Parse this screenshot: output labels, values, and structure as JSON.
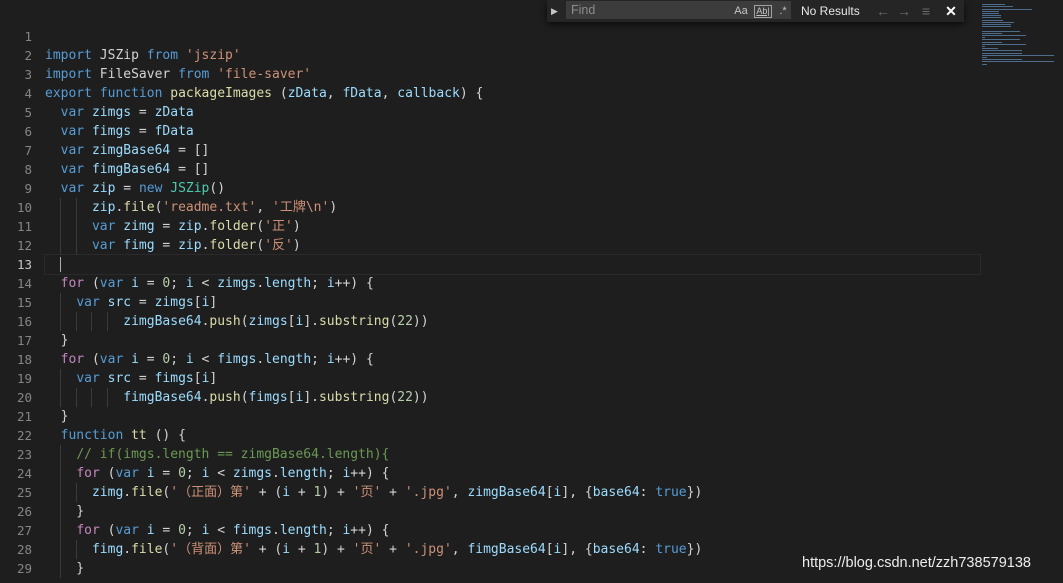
{
  "find": {
    "placeholder": "Find",
    "case_label": "Aa",
    "word_label": "Ab|",
    "regex_label": ".*",
    "results": "No Results"
  },
  "line_numbers": [
    "1",
    "2",
    "3",
    "4",
    "5",
    "6",
    "7",
    "8",
    "9",
    "10",
    "11",
    "12",
    "13",
    "14",
    "15",
    "16",
    "17",
    "18",
    "19",
    "20",
    "21",
    "22",
    "23",
    "24",
    "25",
    "26",
    "27",
    "28",
    "29"
  ],
  "current_line": "13",
  "code": [
    [],
    [
      [
        "kw",
        "import"
      ],
      [
        "tx",
        " JSZip "
      ],
      [
        "kw",
        "from"
      ],
      [
        "tx",
        " "
      ],
      [
        "str",
        "'jszip'"
      ]
    ],
    [
      [
        "kw",
        "import"
      ],
      [
        "tx",
        " FileSaver "
      ],
      [
        "kw",
        "from"
      ],
      [
        "tx",
        " "
      ],
      [
        "str",
        "'file-saver'"
      ]
    ],
    [
      [
        "kw",
        "export"
      ],
      [
        "tx",
        " "
      ],
      [
        "kw",
        "function"
      ],
      [
        "tx",
        " "
      ],
      [
        "fn",
        "packageImages"
      ],
      [
        "tx",
        " ("
      ],
      [
        "var",
        "zData"
      ],
      [
        "tx",
        ", "
      ],
      [
        "var",
        "fData"
      ],
      [
        "tx",
        ", "
      ],
      [
        "var",
        "callback"
      ],
      [
        "tx",
        ") {"
      ]
    ],
    [
      [
        "tx",
        "  "
      ],
      [
        "kw",
        "var"
      ],
      [
        "tx",
        " "
      ],
      [
        "var",
        "zimgs"
      ],
      [
        "tx",
        " = "
      ],
      [
        "var",
        "zData"
      ]
    ],
    [
      [
        "tx",
        "  "
      ],
      [
        "kw",
        "var"
      ],
      [
        "tx",
        " "
      ],
      [
        "var",
        "fimgs"
      ],
      [
        "tx",
        " = "
      ],
      [
        "var",
        "fData"
      ]
    ],
    [
      [
        "tx",
        "  "
      ],
      [
        "kw",
        "var"
      ],
      [
        "tx",
        " "
      ],
      [
        "var",
        "zimgBase64"
      ],
      [
        "tx",
        " = []"
      ]
    ],
    [
      [
        "tx",
        "  "
      ],
      [
        "kw",
        "var"
      ],
      [
        "tx",
        " "
      ],
      [
        "var",
        "fimgBase64"
      ],
      [
        "tx",
        " = []"
      ]
    ],
    [
      [
        "tx",
        "  "
      ],
      [
        "kw",
        "var"
      ],
      [
        "tx",
        " "
      ],
      [
        "var",
        "zip"
      ],
      [
        "tx",
        " = "
      ],
      [
        "kw",
        "new"
      ],
      [
        "tx",
        " "
      ],
      [
        "cls",
        "JSZip"
      ],
      [
        "tx",
        "()"
      ]
    ],
    [
      [
        "tx",
        "      "
      ],
      [
        "var",
        "zip"
      ],
      [
        "tx",
        "."
      ],
      [
        "fn",
        "file"
      ],
      [
        "tx",
        "("
      ],
      [
        "str",
        "'readme.txt'"
      ],
      [
        "tx",
        ", "
      ],
      [
        "str",
        "'工牌\\n'"
      ],
      [
        "tx",
        ")"
      ]
    ],
    [
      [
        "tx",
        "      "
      ],
      [
        "kw",
        "var"
      ],
      [
        "tx",
        " "
      ],
      [
        "var",
        "zimg"
      ],
      [
        "tx",
        " = "
      ],
      [
        "var",
        "zip"
      ],
      [
        "tx",
        "."
      ],
      [
        "fn",
        "folder"
      ],
      [
        "tx",
        "("
      ],
      [
        "str",
        "'正'"
      ],
      [
        "tx",
        ")"
      ]
    ],
    [
      [
        "tx",
        "      "
      ],
      [
        "kw",
        "var"
      ],
      [
        "tx",
        " "
      ],
      [
        "var",
        "fimg"
      ],
      [
        "tx",
        " = "
      ],
      [
        "var",
        "zip"
      ],
      [
        "tx",
        "."
      ],
      [
        "fn",
        "folder"
      ],
      [
        "tx",
        "("
      ],
      [
        "str",
        "'反'"
      ],
      [
        "tx",
        ")"
      ]
    ],
    [],
    [
      [
        "tx",
        "  "
      ],
      [
        "ctl",
        "for"
      ],
      [
        "tx",
        " ("
      ],
      [
        "kw",
        "var"
      ],
      [
        "tx",
        " "
      ],
      [
        "var",
        "i"
      ],
      [
        "tx",
        " = "
      ],
      [
        "num",
        "0"
      ],
      [
        "tx",
        "; "
      ],
      [
        "var",
        "i"
      ],
      [
        "tx",
        " < "
      ],
      [
        "var",
        "zimgs"
      ],
      [
        "tx",
        "."
      ],
      [
        "var",
        "length"
      ],
      [
        "tx",
        "; "
      ],
      [
        "var",
        "i"
      ],
      [
        "tx",
        "++) {"
      ]
    ],
    [
      [
        "tx",
        "    "
      ],
      [
        "kw",
        "var"
      ],
      [
        "tx",
        " "
      ],
      [
        "var",
        "src"
      ],
      [
        "tx",
        " = "
      ],
      [
        "var",
        "zimgs"
      ],
      [
        "tx",
        "["
      ],
      [
        "var",
        "i"
      ],
      [
        "tx",
        "]"
      ]
    ],
    [
      [
        "tx",
        "          "
      ],
      [
        "var",
        "zimgBase64"
      ],
      [
        "tx",
        "."
      ],
      [
        "fn",
        "push"
      ],
      [
        "tx",
        "("
      ],
      [
        "var",
        "zimgs"
      ],
      [
        "tx",
        "["
      ],
      [
        "var",
        "i"
      ],
      [
        "tx",
        "]."
      ],
      [
        "fn",
        "substring"
      ],
      [
        "tx",
        "("
      ],
      [
        "num",
        "22"
      ],
      [
        "tx",
        "))"
      ]
    ],
    [
      [
        "tx",
        "  }"
      ]
    ],
    [
      [
        "tx",
        "  "
      ],
      [
        "ctl",
        "for"
      ],
      [
        "tx",
        " ("
      ],
      [
        "kw",
        "var"
      ],
      [
        "tx",
        " "
      ],
      [
        "var",
        "i"
      ],
      [
        "tx",
        " = "
      ],
      [
        "num",
        "0"
      ],
      [
        "tx",
        "; "
      ],
      [
        "var",
        "i"
      ],
      [
        "tx",
        " < "
      ],
      [
        "var",
        "fimgs"
      ],
      [
        "tx",
        "."
      ],
      [
        "var",
        "length"
      ],
      [
        "tx",
        "; "
      ],
      [
        "var",
        "i"
      ],
      [
        "tx",
        "++) {"
      ]
    ],
    [
      [
        "tx",
        "    "
      ],
      [
        "kw",
        "var"
      ],
      [
        "tx",
        " "
      ],
      [
        "var",
        "src"
      ],
      [
        "tx",
        " = "
      ],
      [
        "var",
        "fimgs"
      ],
      [
        "tx",
        "["
      ],
      [
        "var",
        "i"
      ],
      [
        "tx",
        "]"
      ]
    ],
    [
      [
        "tx",
        "          "
      ],
      [
        "var",
        "fimgBase64"
      ],
      [
        "tx",
        "."
      ],
      [
        "fn",
        "push"
      ],
      [
        "tx",
        "("
      ],
      [
        "var",
        "fimgs"
      ],
      [
        "tx",
        "["
      ],
      [
        "var",
        "i"
      ],
      [
        "tx",
        "]."
      ],
      [
        "fn",
        "substring"
      ],
      [
        "tx",
        "("
      ],
      [
        "num",
        "22"
      ],
      [
        "tx",
        "))"
      ]
    ],
    [
      [
        "tx",
        "  }"
      ]
    ],
    [
      [
        "tx",
        "  "
      ],
      [
        "kw",
        "function"
      ],
      [
        "tx",
        " "
      ],
      [
        "fn",
        "tt"
      ],
      [
        "tx",
        " () {"
      ]
    ],
    [
      [
        "tx",
        "    "
      ],
      [
        "cm",
        "// if(imgs.length == zimgBase64.length){"
      ]
    ],
    [
      [
        "tx",
        "    "
      ],
      [
        "ctl",
        "for"
      ],
      [
        "tx",
        " ("
      ],
      [
        "kw",
        "var"
      ],
      [
        "tx",
        " "
      ],
      [
        "var",
        "i"
      ],
      [
        "tx",
        " = "
      ],
      [
        "num",
        "0"
      ],
      [
        "tx",
        "; "
      ],
      [
        "var",
        "i"
      ],
      [
        "tx",
        " < "
      ],
      [
        "var",
        "zimgs"
      ],
      [
        "tx",
        "."
      ],
      [
        "var",
        "length"
      ],
      [
        "tx",
        "; "
      ],
      [
        "var",
        "i"
      ],
      [
        "tx",
        "++) {"
      ]
    ],
    [
      [
        "tx",
        "      "
      ],
      [
        "var",
        "zimg"
      ],
      [
        "tx",
        "."
      ],
      [
        "fn",
        "file"
      ],
      [
        "tx",
        "("
      ],
      [
        "str",
        "'（正面）第'"
      ],
      [
        "tx",
        " + ("
      ],
      [
        "var",
        "i"
      ],
      [
        "tx",
        " + "
      ],
      [
        "num",
        "1"
      ],
      [
        "tx",
        ") + "
      ],
      [
        "str",
        "'页'"
      ],
      [
        "tx",
        " + "
      ],
      [
        "str",
        "'.jpg'"
      ],
      [
        "tx",
        ", "
      ],
      [
        "var",
        "zimgBase64"
      ],
      [
        "tx",
        "["
      ],
      [
        "var",
        "i"
      ],
      [
        "tx",
        "], {"
      ],
      [
        "var",
        "base64"
      ],
      [
        "tx",
        ": "
      ],
      [
        "kw",
        "true"
      ],
      [
        "tx",
        "})"
      ]
    ],
    [
      [
        "tx",
        "    }"
      ]
    ],
    [
      [
        "tx",
        "    "
      ],
      [
        "ctl",
        "for"
      ],
      [
        "tx",
        " ("
      ],
      [
        "kw",
        "var"
      ],
      [
        "tx",
        " "
      ],
      [
        "var",
        "i"
      ],
      [
        "tx",
        " = "
      ],
      [
        "num",
        "0"
      ],
      [
        "tx",
        "; "
      ],
      [
        "var",
        "i"
      ],
      [
        "tx",
        " < "
      ],
      [
        "var",
        "fimgs"
      ],
      [
        "tx",
        "."
      ],
      [
        "var",
        "length"
      ],
      [
        "tx",
        "; "
      ],
      [
        "var",
        "i"
      ],
      [
        "tx",
        "++) {"
      ]
    ],
    [
      [
        "tx",
        "      "
      ],
      [
        "var",
        "fimg"
      ],
      [
        "tx",
        "."
      ],
      [
        "fn",
        "file"
      ],
      [
        "tx",
        "("
      ],
      [
        "str",
        "'（背面）第'"
      ],
      [
        "tx",
        " + ("
      ],
      [
        "var",
        "i"
      ],
      [
        "tx",
        " + "
      ],
      [
        "num",
        "1"
      ],
      [
        "tx",
        ") + "
      ],
      [
        "str",
        "'页'"
      ],
      [
        "tx",
        " + "
      ],
      [
        "str",
        "'.jpg'"
      ],
      [
        "tx",
        ", "
      ],
      [
        "var",
        "fimgBase64"
      ],
      [
        "tx",
        "["
      ],
      [
        "var",
        "i"
      ],
      [
        "tx",
        "], {"
      ],
      [
        "var",
        "base64"
      ],
      [
        "tx",
        ": "
      ],
      [
        "kw",
        "true"
      ],
      [
        "tx",
        "})"
      ]
    ],
    [
      [
        "tx",
        "    }"
      ]
    ]
  ],
  "watermark": "https://blog.csdn.net/zzh738579138"
}
